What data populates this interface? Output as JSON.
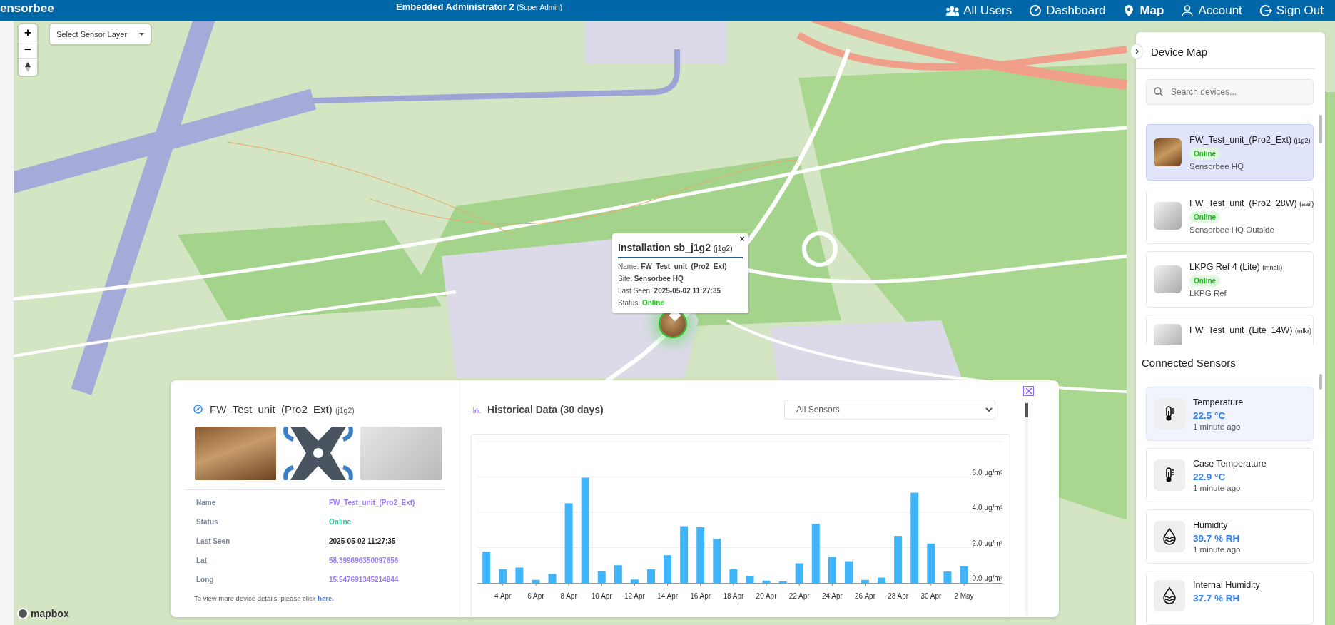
{
  "header": {
    "brand": "ensorbee",
    "user": "Embedded Administrator 2",
    "role": "(Super Admin)",
    "nav": [
      {
        "label": "All Users",
        "selected": false
      },
      {
        "label": "Dashboard",
        "selected": false
      },
      {
        "label": "Map",
        "selected": true
      },
      {
        "label": "Account",
        "selected": false
      },
      {
        "label": "Sign Out",
        "selected": false
      }
    ]
  },
  "map": {
    "zoom_in": "+",
    "zoom_out": "−",
    "layer_select": "Select Sensor Layer",
    "logo": "mapbox",
    "popup": {
      "title": "Installation sb_j1g2",
      "id": "(j1g2)",
      "close": "×",
      "fields": [
        {
          "label": "Name:",
          "value": "FW_Test_unit_(Pro2_Ext)",
          "kind": "text"
        },
        {
          "label": "Site:",
          "value": "Sensorbee HQ",
          "kind": "text"
        },
        {
          "label": "Last Seen:",
          "value": "2025-05-02 11:27:35",
          "kind": "text"
        },
        {
          "label": "Status:",
          "value": "Online",
          "kind": "status"
        }
      ]
    }
  },
  "device_details": {
    "title": "FW_Test_unit_(Pro2_Ext)",
    "id": "(j1g2)",
    "images": [
      {
        "kind": "photo"
      },
      {
        "kind": "logo"
      },
      {
        "kind": "device"
      }
    ],
    "fields": [
      {
        "label": "Name",
        "value": "FW_Test_unit_(Pro2_Ext)",
        "kind": "link"
      },
      {
        "label": "Status",
        "value": "Online",
        "kind": "status"
      },
      {
        "label": "Last Seen",
        "value": "2025-05-02 11:27:35",
        "kind": "text"
      },
      {
        "label": "Lat",
        "value": "58.399696350097656",
        "kind": "link"
      },
      {
        "label": "Long",
        "value": "15.547691345214844",
        "kind": "link"
      }
    ],
    "footer": "To view more device details, please click",
    "footer_link": "here."
  },
  "history": {
    "title": "Historical Data (30 days)",
    "sensor_select": "All Sensors",
    "chart_data": {
      "type": "bar",
      "categories": [
        null,
        "4 Apr",
        null,
        "6 Apr",
        null,
        "8 Apr",
        null,
        "10 Apr",
        null,
        "12 Apr",
        null,
        "14 Apr",
        null,
        "16 Apr",
        null,
        "18 Apr",
        null,
        "20 Apr",
        null,
        "22 Apr",
        null,
        "24 Apr",
        null,
        "26 Apr",
        null,
        "28 Apr",
        null,
        "30 Apr",
        null,
        "2 May"
      ],
      "values": [
        1.77,
        0.77,
        0.87,
        0.17,
        0.51,
        4.51,
        5.96,
        0.66,
        1.0,
        0.19,
        0.77,
        1.57,
        3.21,
        3.15,
        2.51,
        0.77,
        0.4,
        0.13,
        0.06,
        1.11,
        3.34,
        1.47,
        1.23,
        0.17,
        0.3,
        2.66,
        5.11,
        2.23,
        0.64,
        0.94
      ],
      "yticks": [
        {
          "value": 0,
          "label": "0.0 µg/m³"
        },
        {
          "value": 2,
          "label": "2.0 µg/m³"
        },
        {
          "value": 4,
          "label": "4.0 µg/m³"
        },
        {
          "value": 6,
          "label": "6.0 µg/m³"
        }
      ],
      "ylim": [
        0,
        8
      ],
      "grid": true
    }
  },
  "sidebar": {
    "title": "Device Map",
    "search": {
      "placeholder": "Search devices..."
    },
    "devices": [
      {
        "name": "FW_Test_unit_(Pro2_Ext)",
        "id": "(j1g2)",
        "status": "Online",
        "site": "Sensorbee HQ",
        "kind": "photo",
        "selected": true
      },
      {
        "name": "FW_Test_unit_(Pro2_28W)",
        "id": "(aail)",
        "status": "Online",
        "site": "Sensorbee HQ Outside",
        "kind": "device",
        "selected": false
      },
      {
        "name": "LKPG Ref 4 (Lite)",
        "id": "(mnak)",
        "status": "Online",
        "site": "LKPG Ref",
        "kind": "device",
        "selected": false
      },
      {
        "name": "FW_Test_unit_(Lite_14W)",
        "id": "(mlkr)",
        "kind": "device",
        "selected": false
      }
    ],
    "sensors_title": "Connected Sensors",
    "sensors": [
      {
        "name": "Temperature",
        "value": "22.5 °C",
        "updated": "1 minute ago",
        "kind": "temperature",
        "selected": true
      },
      {
        "name": "Case Temperature",
        "value": "22.9 °C",
        "updated": "1 minute ago",
        "kind": "temperature",
        "selected": false
      },
      {
        "name": "Humidity",
        "value": "39.7 % RH",
        "updated": "1 minute ago",
        "kind": "humidity",
        "selected": false
      },
      {
        "name": "Internal Humidity",
        "value": "37.7 % RH",
        "kind": "humidity",
        "selected": false
      }
    ]
  }
}
